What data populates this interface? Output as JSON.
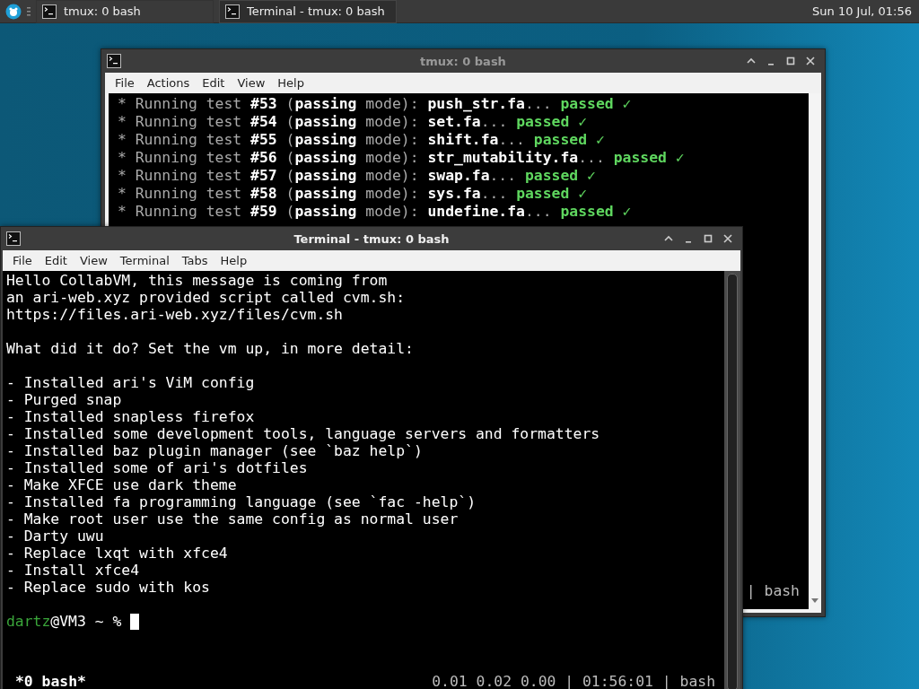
{
  "taskbar": {
    "tasks": [
      {
        "label": "tmux: 0 bash",
        "selected": false
      },
      {
        "label": "Terminal - tmux: 0 bash",
        "selected": true
      }
    ],
    "clock": "Sun 10 Jul, 01:56"
  },
  "back_window": {
    "title": "tmux: 0 bash",
    "active": false,
    "menu": [
      "File",
      "Actions",
      "Edit",
      "View",
      "Help"
    ],
    "lines": [
      {
        "text": "* Running test **#53** (**passing** mode): **push_str.fa**...",
        "status": "passed ✓"
      },
      {
        "text": "* Running test **#54** (**passing** mode): **set.fa**...",
        "status": "passed ✓"
      },
      {
        "text": "* Running test **#55** (**passing** mode): **shift.fa**...",
        "status": "passed ✓"
      },
      {
        "text": "* Running test **#56** (**passing** mode): **str_mutability.fa**...",
        "status": "passed ✓"
      },
      {
        "text": "* Running test **#57** (**passing** mode): **swap.fa**...",
        "status": "passed ✓"
      },
      {
        "text": "* Running test **#58** (**passing** mode): **sys.fa**...",
        "status": "passed ✓"
      },
      {
        "text": "* Running test **#59** (**passing** mode): **undefine.fa**...",
        "status": "passed ✓"
      }
    ],
    "status_right": "| bash"
  },
  "front_window": {
    "title": "Terminal - tmux: 0 bash",
    "active": true,
    "menu": [
      "File",
      "Edit",
      "View",
      "Terminal",
      "Tabs",
      "Help"
    ],
    "blocks": [
      [
        "Hello CollabVM, this message is coming from",
        "an ari-web.xyz provided script called cvm.sh:",
        "https://files.ari-web.xyz/files/cvm.sh"
      ],
      [
        "What did it do? Set the vm up, in more detail:"
      ],
      [
        "- Installed ari's ViM config",
        "- Purged snap",
        "- Installed snapless firefox",
        "- Installed some development tools, language servers and formatters",
        "- Installed baz plugin manager (see `baz help`)",
        "- Installed some of ari's dotfiles",
        "- Make XFCE use dark theme",
        "- Installed fa programming language (see `fac -help`)",
        "- Make root user use the same config as normal user",
        "- Darty uwu",
        "- Replace lxqt with xfce4",
        "- Install xfce4",
        "- Replace sudo with kos"
      ]
    ],
    "prompt": {
      "user": "dartz",
      "rest": "@VM3 ~ %"
    },
    "status_left": "*0 bash*",
    "status_right": "0.01 0.02 0.00 | 01:56:01 | bash"
  }
}
